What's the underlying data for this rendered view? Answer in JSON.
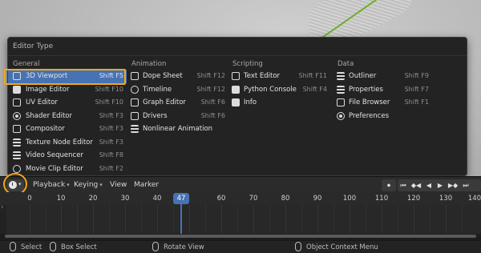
{
  "menu": {
    "title": "Editor Type",
    "general": {
      "heading": "General",
      "items": [
        {
          "label": "3D Viewport",
          "shortcut": "Shift F5",
          "icon": "cube-icon"
        },
        {
          "label": "Image Editor",
          "shortcut": "Shift F10",
          "icon": "image-icon"
        },
        {
          "label": "UV Editor",
          "shortcut": "Shift F10",
          "icon": "uv-icon"
        },
        {
          "label": "Shader Editor",
          "shortcut": "Shift F3",
          "icon": "shader-icon"
        },
        {
          "label": "Compositor",
          "shortcut": "Shift F3",
          "icon": "compositor-icon"
        },
        {
          "label": "Texture Node Editor",
          "shortcut": "Shift F3",
          "icon": "texture-icon"
        },
        {
          "label": "Video Sequencer",
          "shortcut": "Shift F8",
          "icon": "sequencer-icon"
        },
        {
          "label": "Movie Clip Editor",
          "shortcut": "Shift F2",
          "icon": "clip-icon"
        }
      ]
    },
    "animation": {
      "heading": "Animation",
      "items": [
        {
          "label": "Dope Sheet",
          "shortcut": "Shift F12",
          "icon": "dopesheet-icon"
        },
        {
          "label": "Timeline",
          "shortcut": "Shift F12",
          "icon": "clock-icon"
        },
        {
          "label": "Graph Editor",
          "shortcut": "Shift F6",
          "icon": "graph-icon"
        },
        {
          "label": "Drivers",
          "shortcut": "Shift F6",
          "icon": "drivers-icon"
        },
        {
          "label": "Nonlinear Animation",
          "shortcut": "",
          "icon": "nla-icon"
        }
      ]
    },
    "scripting": {
      "heading": "Scripting",
      "items": [
        {
          "label": "Text Editor",
          "shortcut": "Shift F11",
          "icon": "text-icon"
        },
        {
          "label": "Python Console",
          "shortcut": "Shift F4",
          "icon": "console-icon"
        },
        {
          "label": "Info",
          "shortcut": "",
          "icon": "info-icon"
        }
      ]
    },
    "data": {
      "heading": "Data",
      "items": [
        {
          "label": "Outliner",
          "shortcut": "Shift F9",
          "icon": "outliner-icon"
        },
        {
          "label": "Properties",
          "shortcut": "Shift F7",
          "icon": "properties-icon"
        },
        {
          "label": "File Browser",
          "shortcut": "Shift F1",
          "icon": "filebrowser-icon"
        },
        {
          "label": "Preferences",
          "shortcut": "",
          "icon": "gear-icon"
        }
      ]
    }
  },
  "timeline": {
    "menus": [
      "Playback",
      "Keying",
      "View",
      "Marker"
    ],
    "current_frame": "47",
    "ruler_labels": [
      "0",
      "10",
      "20",
      "30",
      "40",
      "50",
      "60",
      "70",
      "80",
      "90",
      "100",
      "110",
      "120",
      "130",
      "140"
    ],
    "transport": [
      "⏺",
      "⏮",
      "◆◀",
      "◀",
      "▶",
      "▶◆",
      "⏭"
    ]
  },
  "status_bar": {
    "items": [
      "Select",
      "Box Select",
      "Rotate View",
      "Object Context Menu"
    ]
  }
}
